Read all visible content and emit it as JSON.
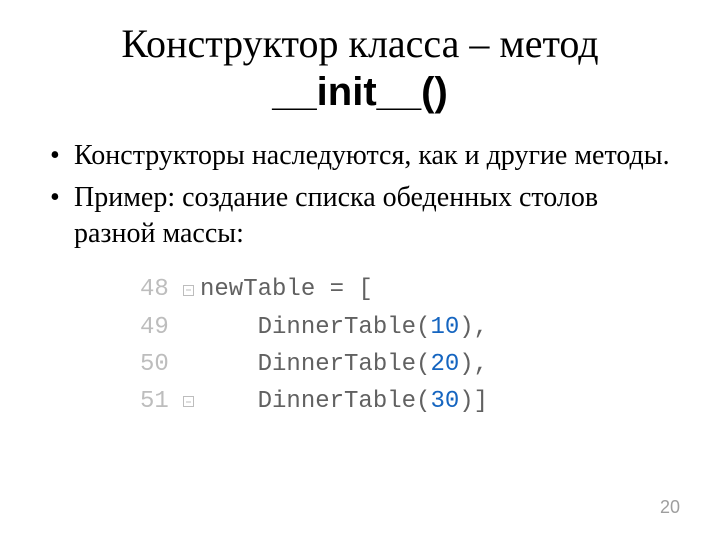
{
  "title": {
    "line1_pre": "Конструктор класса – метод",
    "line2_emph": "__init__()"
  },
  "bullets": [
    "Конструкторы наследуются, как и другие методы.",
    "Пример: создание списка обеденных столов разной массы:"
  ],
  "code": {
    "lines": [
      {
        "num": "48",
        "fold": "open",
        "pre": "newTable = [",
        "arg": "",
        "post": ""
      },
      {
        "num": "49",
        "fold": "mid",
        "pre": "    DinnerTable(",
        "arg": "10",
        "post": "),"
      },
      {
        "num": "50",
        "fold": "mid",
        "pre": "    DinnerTable(",
        "arg": "20",
        "post": "),"
      },
      {
        "num": "51",
        "fold": "close",
        "pre": "    DinnerTable(",
        "arg": "30",
        "post": ")]"
      }
    ]
  },
  "page_number": "20"
}
